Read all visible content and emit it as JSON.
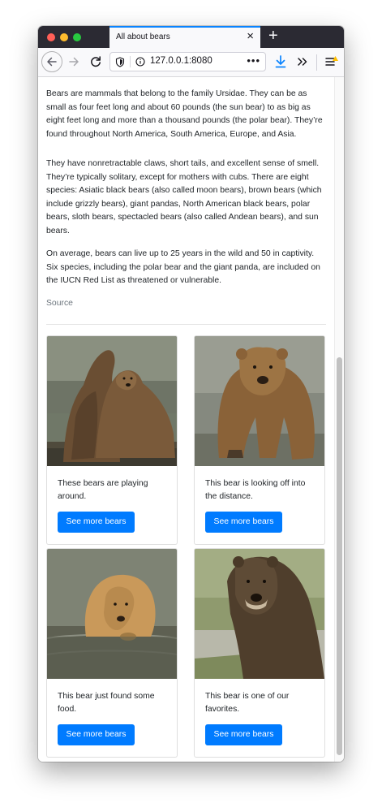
{
  "colors": {
    "accent": "#007bff",
    "tab_strip": "#2b2a33",
    "traffic_red": "#ff5f57",
    "traffic_yellow": "#febc2e",
    "traffic_green": "#28c840",
    "download_icon": "#0a84ff",
    "notification_badge": "#ffbf00"
  },
  "browser": {
    "tab_title": "All about bears",
    "url": "127.0.0.1:8080",
    "icons": {
      "back": "back-arrow-icon",
      "forward": "forward-arrow-icon",
      "reload": "reload-icon",
      "tracking": "shield-icon",
      "info": "info-icon",
      "more": "ellipsis-icon",
      "downloads": "download-arrow-icon",
      "overflow": "double-chevron-icon",
      "menu": "hamburger-menu-icon"
    }
  },
  "article": {
    "paragraphs": [
      "Bears are mammals that belong to the family Ursidae. They can be as small as four feet long and about 60 pounds (the sun bear) to as big as eight feet long and more than a thousand pounds (the polar bear). They’re found throughout North America, South America, Europe, and Asia.",
      "They have nonretractable claws, short tails, and excellent sense of smell. They’re typically solitary, except for mothers with cubs. There are eight species: Asiatic black bears (also called moon bears), brown bears (which include grizzly bears), giant pandas, North American black bears, polar bears, sloth bears, spectacled bears (also called Andean bears), and sun bears.",
      "On average, bears can live up to 25 years in the wild and 50 in captivity. Six species, including the polar bear and the giant panda, are included on the IUCN Red List as threatened or vulnerable."
    ],
    "source_label": "Source"
  },
  "cards": [
    {
      "text": "These bears are playing around.",
      "button": "See more bears",
      "image": "two-bears-playing-photo"
    },
    {
      "text": "This bear is looking off into the distance.",
      "button": "See more bears",
      "image": "bear-standing-photo"
    },
    {
      "text": "This bear just found some food.",
      "button": "See more bears",
      "image": "bear-in-water-photo"
    },
    {
      "text": "This bear is one of our favorites.",
      "button": "See more bears",
      "image": "dark-bear-portrait-photo"
    }
  ]
}
